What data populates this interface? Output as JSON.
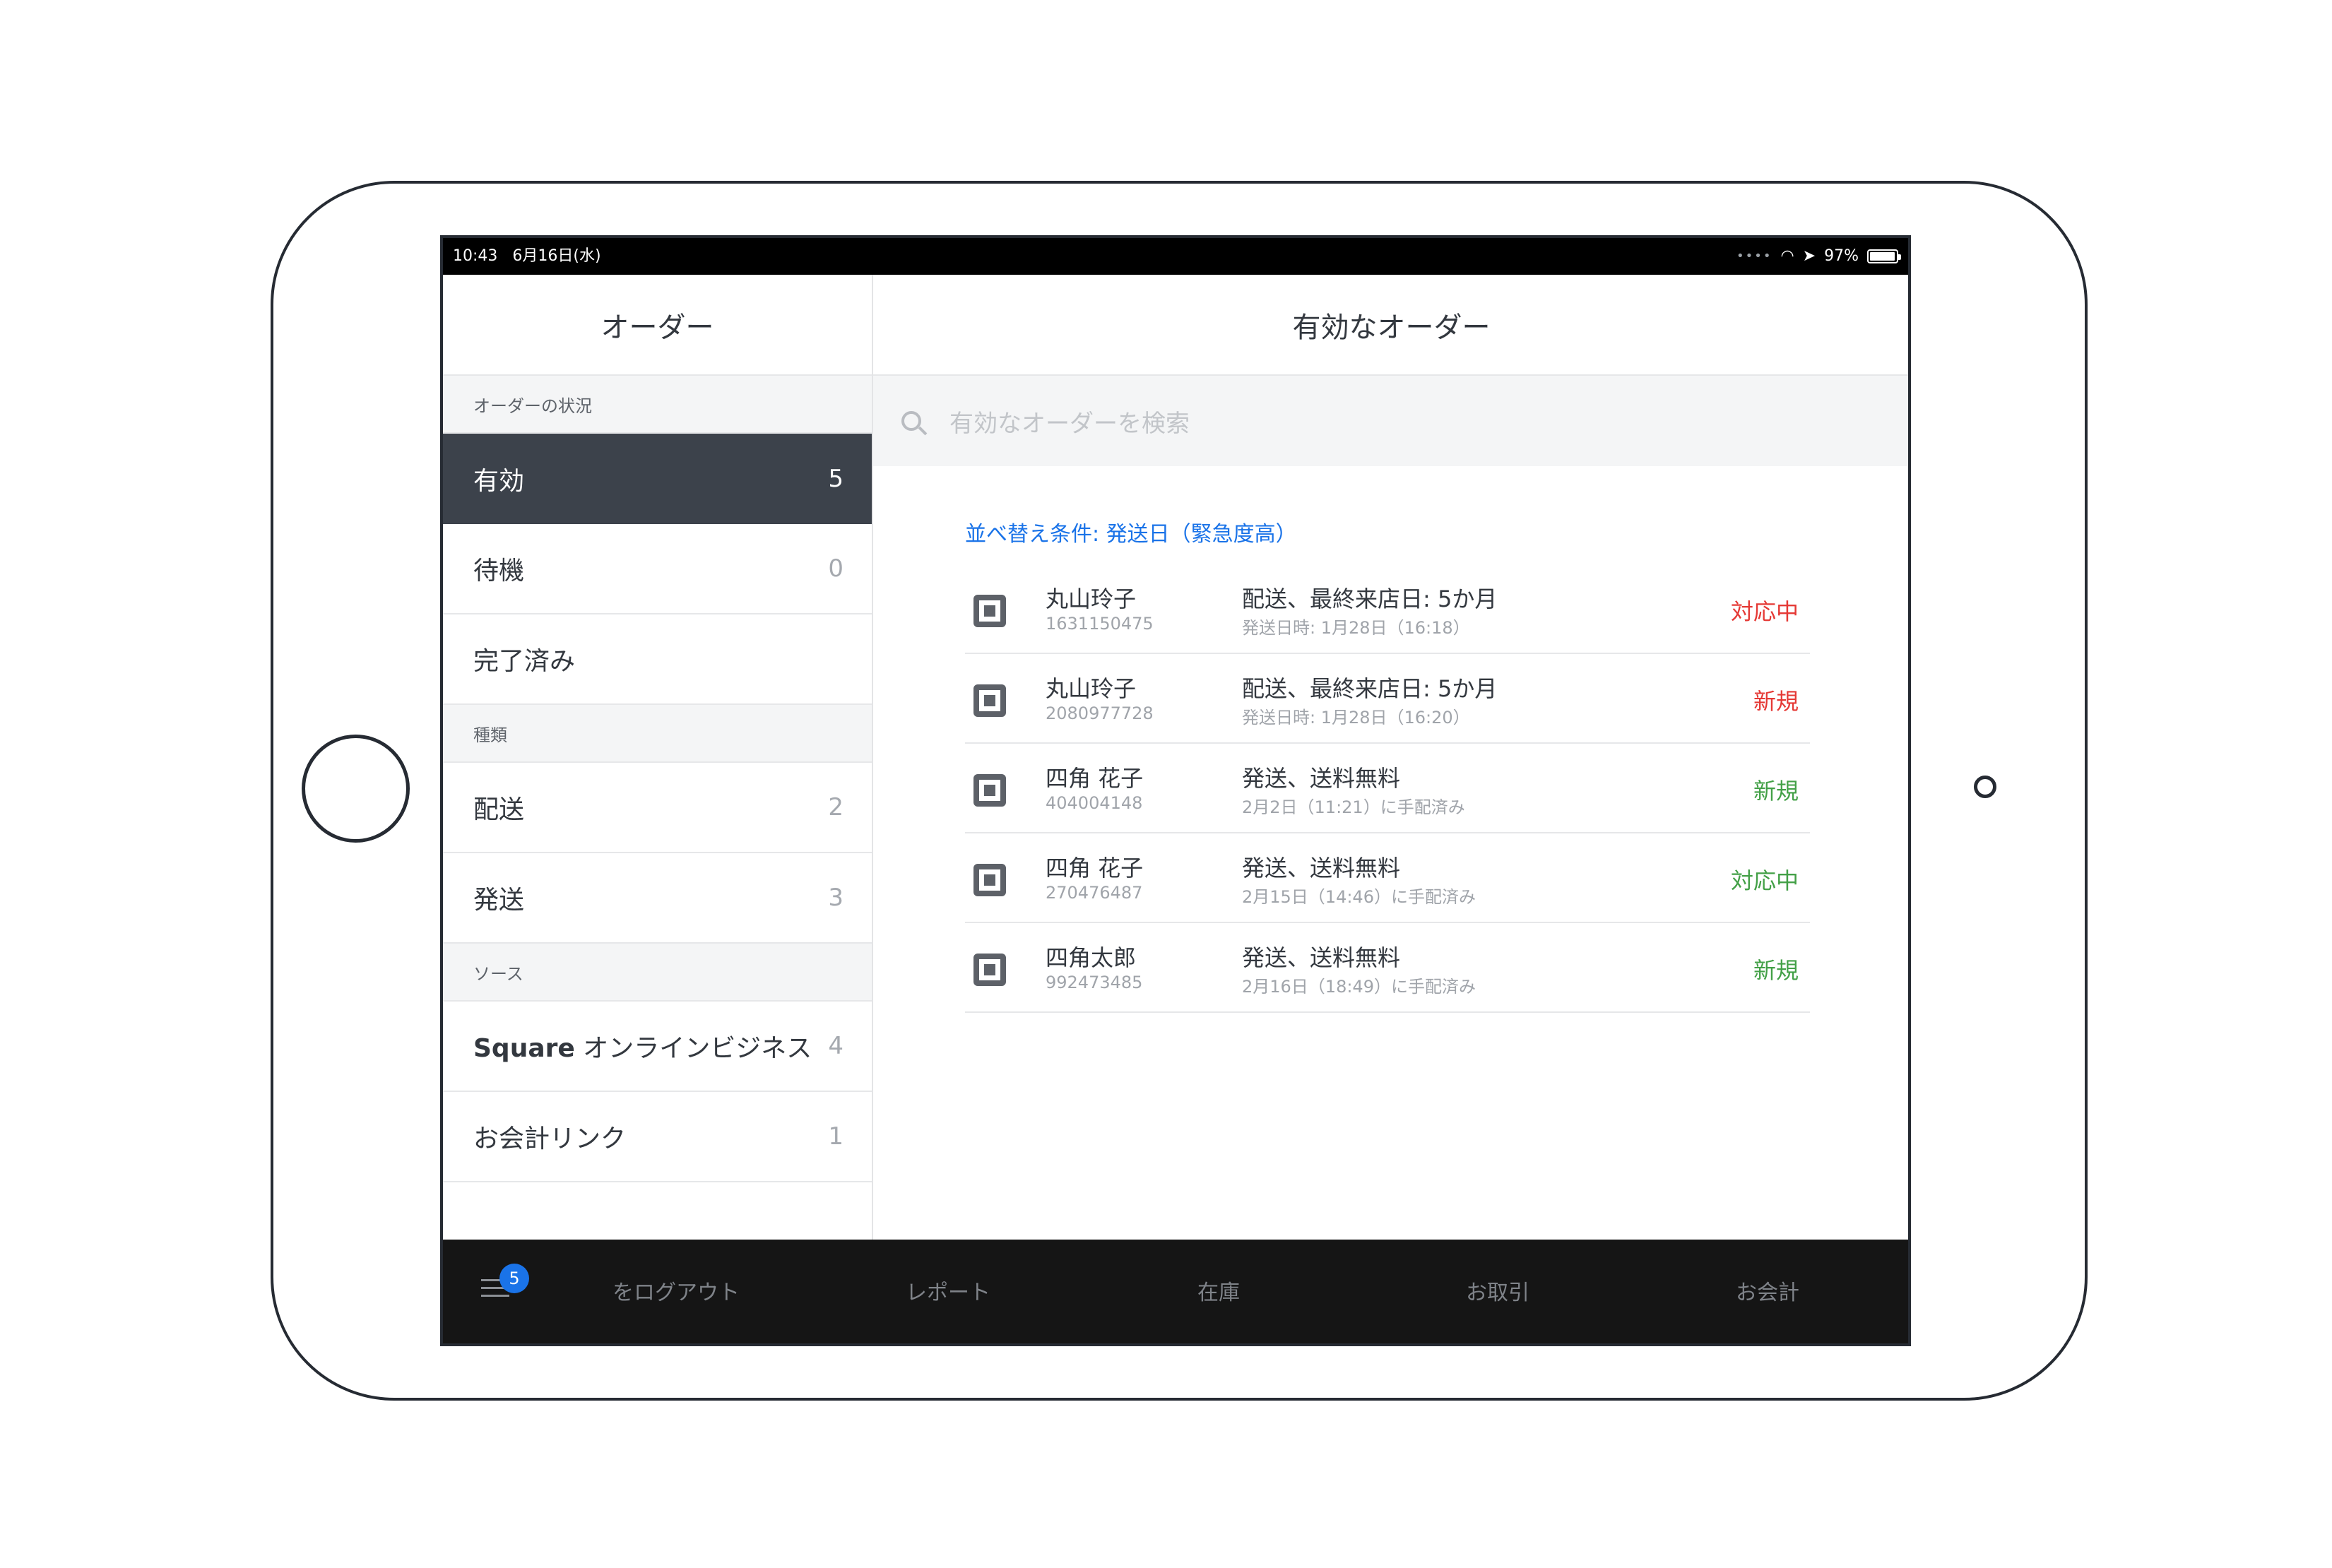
{
  "statusbar": {
    "time": "10:43",
    "date": "6月16日(水)",
    "battery": "97%",
    "battery_level": 0.97
  },
  "sidebar": {
    "title": "オーダー",
    "sections": [
      {
        "title": "オーダーの状況",
        "items": [
          {
            "label": "有効",
            "count": "5"
          },
          {
            "label": "待機",
            "count": "0"
          },
          {
            "label": "完了済み",
            "count": ""
          }
        ]
      },
      {
        "title": "種類",
        "items": [
          {
            "label": "配送",
            "count": "2"
          },
          {
            "label": "発送",
            "count": "3"
          }
        ]
      },
      {
        "title": "ソース",
        "items": [
          {
            "label_bold": "Square",
            "label": " オンラインビジネス",
            "count": "4"
          },
          {
            "label": "お会計リンク",
            "count": "1"
          }
        ]
      }
    ]
  },
  "main": {
    "title": "有効なオーダー",
    "search_placeholder": "有効なオーダーを検索",
    "sort_label": "並べ替え条件: 発送日（緊急度高）",
    "orders": [
      {
        "name": "丸山玲子",
        "id": "1631150475",
        "desc": "配送、最終来店日: 5か月",
        "sub": "発送日時: 1月28日（16:18）",
        "status": "対応中",
        "status_color": "#e53935"
      },
      {
        "name": "丸山玲子",
        "id": "2080977728",
        "desc": "配送、最終来店日: 5か月",
        "sub": "発送日時: 1月28日（16:20）",
        "status": "新規",
        "status_color": "#e53935"
      },
      {
        "name": "四角 花子",
        "id": "404004148",
        "desc": "発送、送料無料",
        "sub": "2月2日（11:21）に手配済み",
        "status": "新規",
        "status_color": "#43a047"
      },
      {
        "name": "四角 花子",
        "id": "270476487",
        "desc": "発送、送料無料",
        "sub": "2月15日（14:46）に手配済み",
        "status": "対応中",
        "status_color": "#43a047"
      },
      {
        "name": "四角太郎",
        "id": "992473485",
        "desc": "発送、送料無料",
        "sub": "2月16日（18:49）に手配済み",
        "status": "新規",
        "status_color": "#43a047"
      }
    ]
  },
  "tabbar": {
    "badge": "5",
    "tabs": [
      "をログアウト",
      "レポート",
      "在庫",
      "お取引",
      "お会計"
    ]
  }
}
